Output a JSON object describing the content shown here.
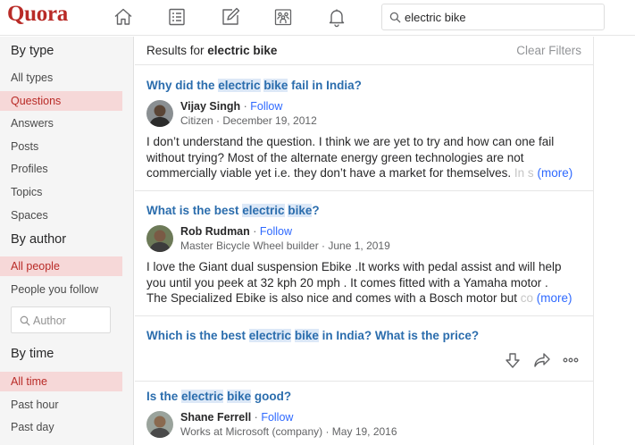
{
  "header": {
    "logo": "Quora",
    "nav_icons": [
      "home-icon",
      "answer-icon",
      "write-icon",
      "spaces-icon",
      "notifications-icon"
    ],
    "search_value": "electric bike"
  },
  "sidebar": {
    "by_type": {
      "heading": "By type",
      "items": [
        {
          "label": "All types",
          "active": false
        },
        {
          "label": "Questions",
          "active": true
        },
        {
          "label": "Answers",
          "active": false
        },
        {
          "label": "Posts",
          "active": false
        },
        {
          "label": "Profiles",
          "active": false
        },
        {
          "label": "Topics",
          "active": false
        },
        {
          "label": "Spaces",
          "active": false
        }
      ]
    },
    "by_author": {
      "heading": "By author",
      "items": [
        {
          "label": "All people",
          "active": true
        },
        {
          "label": "People you follow",
          "active": false
        }
      ],
      "input_placeholder": "Author"
    },
    "by_time": {
      "heading": "By time",
      "items": [
        {
          "label": "All time",
          "active": true
        },
        {
          "label": "Past hour",
          "active": false
        },
        {
          "label": "Past day",
          "active": false
        }
      ]
    }
  },
  "results": {
    "label": "Results for",
    "query": "electric bike",
    "clear_filters": "Clear Filters",
    "items": [
      {
        "title_parts": [
          "Why did the ",
          "electric",
          " ",
          "bike",
          " fail in India?"
        ],
        "author": "Vijay Singh",
        "follow": "Follow",
        "sep": " · ",
        "meta": "Citizen · December 19, 2012",
        "answer_lines": [
          "I don’t understand the question. I think we are yet to try and how can one fail",
          "without trying? Most of the alternate energy green technologies are not",
          "commercially viable yet i.e. they don’t have a market for themselves."
        ],
        "fade_text": " In s",
        "more": "(more)"
      },
      {
        "title_parts": [
          "What is the best ",
          "electric",
          " ",
          "bike",
          "?"
        ],
        "author": "Rob Rudman",
        "follow": "Follow",
        "sep": " · ",
        "meta": "Master Bicycle Wheel builder · June 1, 2019",
        "answer_lines": [
          "I love the Giant dual suspension Ebike .It works with pedal assist and will help",
          "you until you peek at 32 kph 20 mph . It comes fitted with a Yamaha motor .",
          "The Specialized Ebike is also nice and comes with a Bosch motor but"
        ],
        "fade_text": " co",
        "more": "(more)"
      },
      {
        "title_parts": [
          "Which is the best ",
          "electric",
          " ",
          "bike",
          " in India? What is the price?"
        ],
        "action_icons": [
          "downvote-icon",
          "share-icon",
          "more-options-icon"
        ]
      },
      {
        "title_parts": [
          "Is the ",
          "electric",
          " ",
          "bike",
          " good?"
        ],
        "author": "Shane Ferrell",
        "follow": "Follow",
        "sep": " · ",
        "meta": "Works at Microsoft (company) · May 19, 2016"
      }
    ]
  }
}
